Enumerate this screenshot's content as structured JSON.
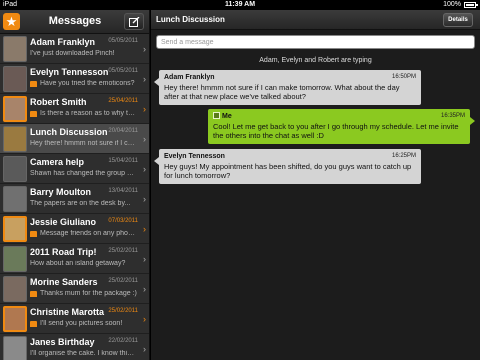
{
  "status_bar": {
    "carrier": "iPad",
    "time": "11:39 AM",
    "battery": "100%"
  },
  "sidebar": {
    "title": "Messages",
    "conversations": [
      {
        "name": "Adam Franklyn",
        "date": "05/05/2011",
        "preview": "I've just downloaded Pinch!",
        "badge": false,
        "highlight": false,
        "avatar_color": "#8a7a6a"
      },
      {
        "name": "Evelyn Tennesson",
        "date": "05/05/2011",
        "preview": "Have you tried the emoticons?",
        "badge": true,
        "highlight": false,
        "avatar_color": "#6a5a55"
      },
      {
        "name": "Robert Smith",
        "date": "25/04/2011",
        "preview": "Is there a reason as to why there ...",
        "badge": true,
        "highlight": true,
        "avatar_color": "#a8846a"
      },
      {
        "name": "Lunch Discussion",
        "date": "20/04/2011",
        "preview": "Hey there! hmmm not sure if I can ...",
        "badge": false,
        "highlight": false,
        "avatar_color": "#9a7a40"
      },
      {
        "name": "Camera help",
        "date": "15/04/2011",
        "preview": "Shawn has changed the group pic...",
        "badge": false,
        "highlight": false,
        "avatar_color": "#5a5a5a"
      },
      {
        "name": "Barry Moulton",
        "date": "13/04/2011",
        "preview": "The papers are on the desk by...",
        "badge": false,
        "highlight": false,
        "avatar_color": "#707070"
      },
      {
        "name": "Jessie Giuliano",
        "date": "07/03/2011",
        "preview": "Message friends on any phone!",
        "badge": true,
        "highlight": true,
        "avatar_color": "#c8a060"
      },
      {
        "name": "2011 Road Trip!",
        "date": "25/02/2011",
        "preview": "How about an island getaway?",
        "badge": false,
        "highlight": false,
        "avatar_color": "#6a7a5a"
      },
      {
        "name": "Morine Sanders",
        "date": "25/02/2011",
        "preview": "Thanks mum for the package :)",
        "badge": true,
        "highlight": false,
        "avatar_color": "#7a6a60"
      },
      {
        "name": "Christine Marotta",
        "date": "25/02/2011",
        "preview": "I'll send you pictures soon!",
        "badge": true,
        "highlight": true,
        "avatar_color": "#b07850"
      },
      {
        "name": "Janes Birthday",
        "date": "22/02/2011",
        "preview": "I'll organise the cake. I know this ...",
        "badge": false,
        "highlight": false,
        "avatar_color": "#8a8a8a"
      }
    ]
  },
  "chat": {
    "title": "Lunch Discussion",
    "details_label": "Details",
    "input_placeholder": "Send a message",
    "typing_text": "Adam, Evelyn and Robert are typing",
    "messages": [
      {
        "sender": "Adam Franklyn",
        "time": "16:50PM",
        "text": "Hey there! hmmm not sure if I can make tomorrow. What about the day after at that new place we've talked about?",
        "mine": false
      },
      {
        "sender": "Me",
        "time": "16:35PM",
        "text": "Cool! Let me get back to you after I go through my schedule. Let me invite the others into the chat as well :D",
        "mine": true
      },
      {
        "sender": "Evelyn Tennesson",
        "time": "16:25PM",
        "text": "Hey guys! My appointment has been shifted, do you guys want to catch up for lunch tomorrow?",
        "mine": false
      }
    ]
  },
  "colors": {
    "accent": "#f08a12",
    "my_bubble": "#8bc920",
    "their_bubble": "#d4d4d4"
  }
}
